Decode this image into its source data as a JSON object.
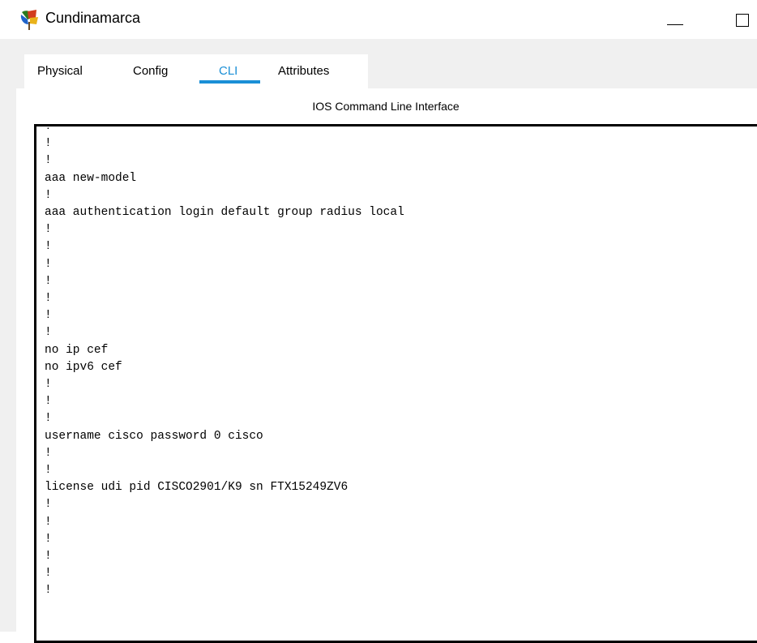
{
  "window": {
    "title": "Cundinamarca",
    "icon": "router-device-icon"
  },
  "tabs": [
    {
      "label": "Physical",
      "active": false
    },
    {
      "label": "Config",
      "active": false
    },
    {
      "label": "CLI",
      "active": true
    },
    {
      "label": "Attributes",
      "active": false
    }
  ],
  "panel": {
    "heading": "IOS Command Line Interface"
  },
  "terminal": {
    "lines": [
      "!",
      "!",
      "!",
      "aaa new-model",
      "!",
      "aaa authentication login default group radius local",
      "!",
      "!",
      "!",
      "!",
      "!",
      "!",
      "!",
      "no ip cef",
      "no ipv6 cef",
      "!",
      "!",
      "!",
      "username cisco password 0 cisco",
      "!",
      "!",
      "license udi pid CISCO2901/K9 sn FTX15249ZV6",
      "!",
      "!",
      "!",
      "!",
      "!",
      "!"
    ]
  },
  "colors": {
    "accent": "#1a8fd6",
    "background": "#f0f0f0",
    "panel": "#ffffff"
  }
}
